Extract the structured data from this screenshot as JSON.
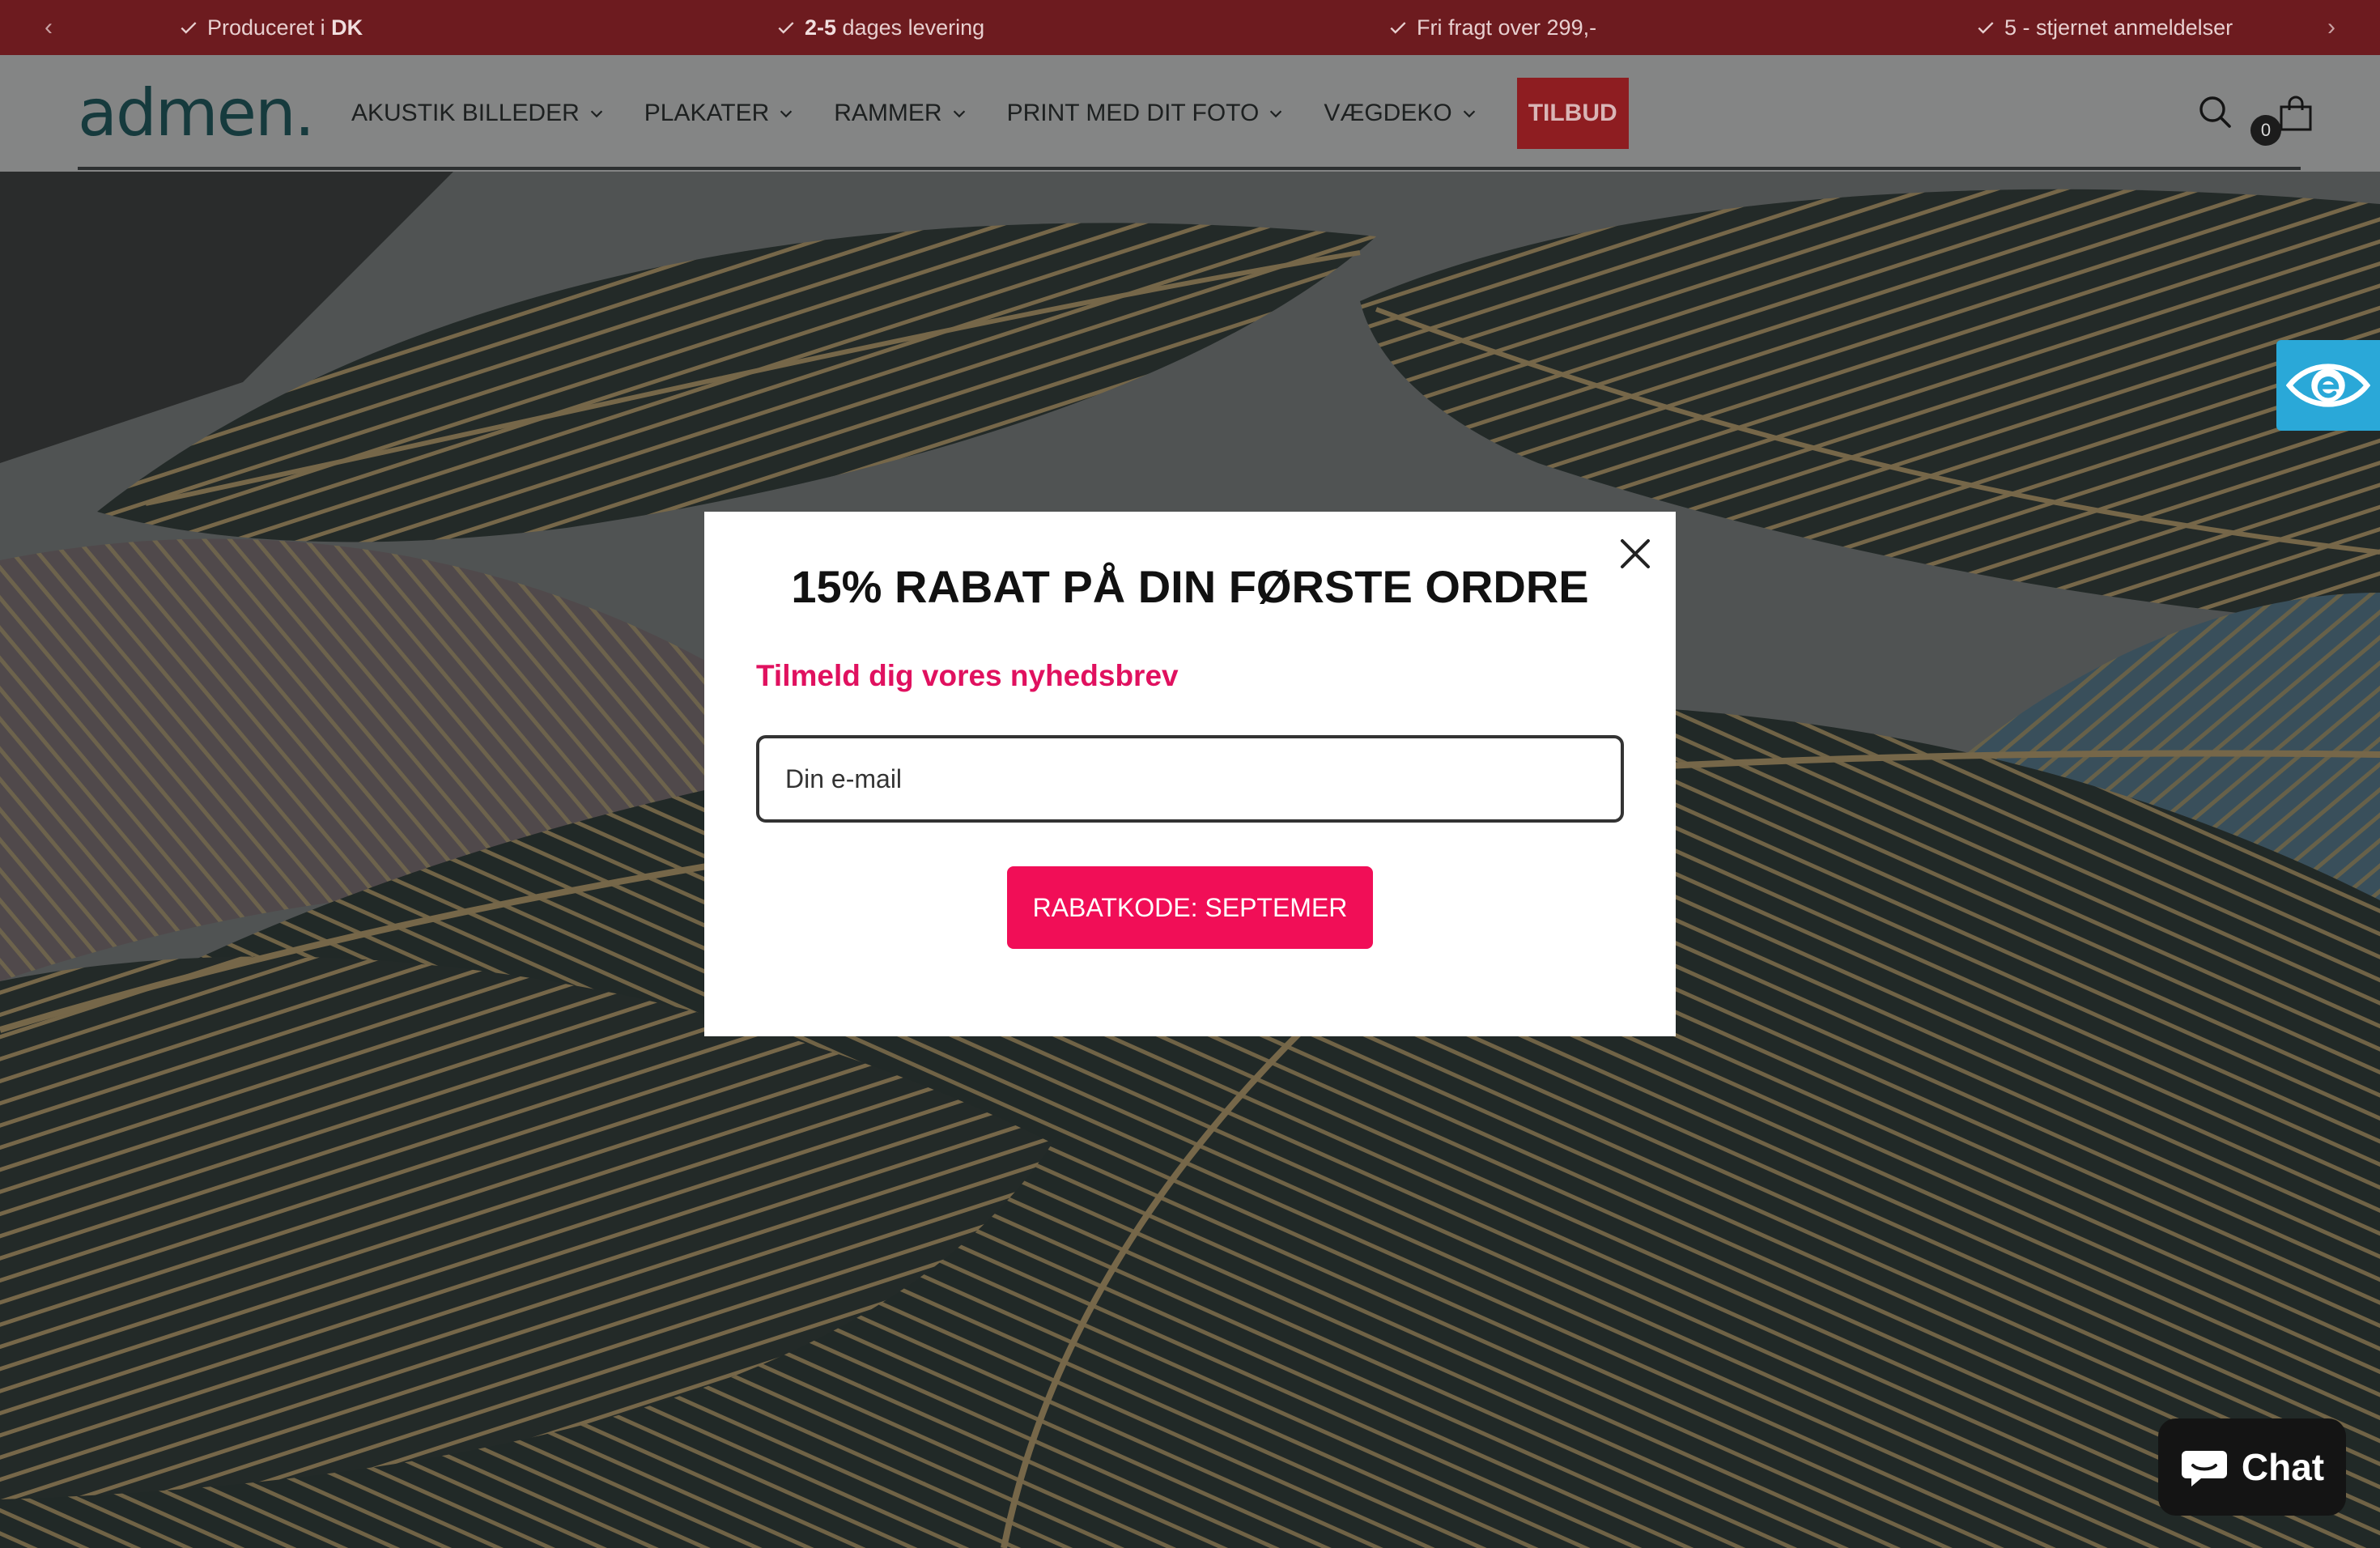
{
  "announcement_bar": {
    "items": [
      {
        "text": "Produceret i ",
        "bold": "DK"
      },
      {
        "bold": "2-5",
        "text": " dages levering"
      },
      {
        "text": "Fri fragt over 299,-"
      },
      {
        "text": "5 - stjernet anmeldelser"
      }
    ],
    "prev_arrow": "‹",
    "next_arrow": "›"
  },
  "header": {
    "logo_text": "admen.",
    "nav": [
      {
        "label": "AKUSTIK BILLEDER"
      },
      {
        "label": "PLAKATER"
      },
      {
        "label": "RAMMER"
      },
      {
        "label": "PRINT MED DIT FOTO"
      },
      {
        "label": "VÆGDEKO"
      }
    ],
    "promo_label": "TILBUD",
    "cart_count": "0"
  },
  "modal": {
    "title": "15% RABAT PÅ DIN FØRSTE ORDRE",
    "subtitle": "Tilmeld dig vores nyhedsbrev",
    "email_placeholder": "Din e-mail",
    "button_label": "RABATKODE: SEPTEMER"
  },
  "chat": {
    "label": "Chat"
  },
  "colors": {
    "announcement_bg": "#6d1b1f",
    "promo_bg": "#8e1d21",
    "accent_pink": "#f10e57",
    "subtitle_pink": "#e0115f",
    "accessibility_blue": "#2aa8d8"
  },
  "icons": [
    "check-icon",
    "chevron-down-icon",
    "search-icon",
    "bag-icon",
    "close-icon",
    "eye-icon",
    "chat-bubble-icon"
  ]
}
